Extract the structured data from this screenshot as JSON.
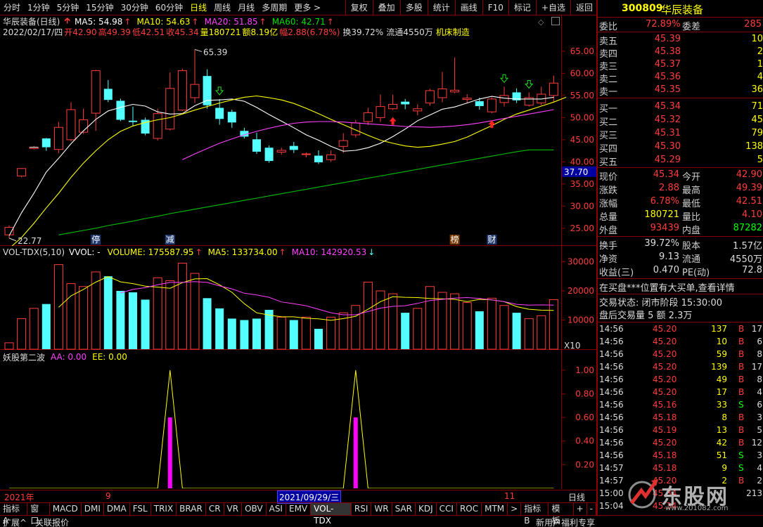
{
  "toolbar": {
    "periods": [
      "分时",
      "1分钟",
      "5分钟",
      "15分钟",
      "30分钟",
      "60分钟",
      "日线",
      "周线",
      "月线",
      "多周期",
      "更多 >"
    ],
    "active_period": "日线",
    "actions": [
      "复权",
      "叠加",
      "多股",
      "统计",
      "画线",
      "F10",
      "标记",
      "+自选",
      "返回"
    ]
  },
  "chart_header": {
    "name": "华辰装备(日线)",
    "ma5": "MA5: 54.98",
    "ma10": "MA10: 54.63",
    "ma20": "MA20: 51.85",
    "ma60": "MA60: 42.71",
    "date": "2022/02/17/四",
    "open": "开42.90",
    "high": "高49.39",
    "low": "低42.51",
    "close": "收45.34",
    "volume": "量180721",
    "amount": "额8.19亿",
    "amplitude": "幅2.88(6.78%)",
    "turnover": "换39.72%",
    "float": "流通4550万",
    "industry": "机床制造"
  },
  "price_axis": [
    "65.00",
    "60.00",
    "55.00",
    "50.00",
    "45.00",
    "40.00",
    "35.00",
    "30.00",
    "25.00"
  ],
  "price_marker": "37.70",
  "annotations": {
    "high_label": "65.39",
    "low_label": "22.77",
    "tags": [
      "停",
      "减",
      "榜",
      "财"
    ]
  },
  "volume_header": {
    "name": "VOL-TDX(5,10)",
    "vvol": "VVOL: -",
    "volume": "VOLUME: 175587.95",
    "ma5": "MA5: 133734.00",
    "ma10": "MA10: 142920.53"
  },
  "volume_axis": [
    "30000",
    "20000",
    "10000"
  ],
  "volume_unit": "X10",
  "indicator_header": {
    "name": "妖股第二波",
    "aa": "AA: 0.00",
    "ee": "EE: 0.00"
  },
  "indicator_axis": [
    "1.00",
    "0.80",
    "0.60",
    "0.40",
    "0.20"
  ],
  "time_axis": {
    "left": "2021年",
    "mark1": "9",
    "highlight": "2021/09/29/三",
    "mark2": "11",
    "right": "日线"
  },
  "bottom_tabs": [
    "指标A",
    "窗口",
    "MACD",
    "DMI",
    "DMA",
    "FSL",
    "TRIX",
    "BRAR",
    "CR",
    "VR",
    "OBV",
    "ASI",
    "EMV",
    "VOL-TDX",
    "RSI",
    "WR",
    "SAR",
    "KDJ",
    "CCI",
    "ROC",
    "MTM",
    ">",
    "指标B",
    "模 板",
    "+",
    "-"
  ],
  "active_tab": "VOL-TDX",
  "status_bar": {
    "left1": "扩展^",
    "left2": "关联报价",
    "right1": "新用户福利专享",
    "watermark": "东股网",
    "watermark_url": "www.201082.com"
  },
  "quote": {
    "code": "300809",
    "name": "华辰装备",
    "weibi_label": "委比",
    "weibi": "72.89%",
    "weicha_label": "委差",
    "weicha": "285",
    "sells": [
      {
        "label": "卖五",
        "price": "45.39",
        "qty": "10"
      },
      {
        "label": "卖四",
        "price": "45.38",
        "qty": "2"
      },
      {
        "label": "卖三",
        "price": "45.37",
        "qty": "1"
      },
      {
        "label": "卖二",
        "price": "45.36",
        "qty": "4"
      },
      {
        "label": "卖一",
        "price": "45.35",
        "qty": "36"
      }
    ],
    "buys": [
      {
        "label": "买一",
        "price": "45.34",
        "qty": "71"
      },
      {
        "label": "买二",
        "price": "45.32",
        "qty": "45"
      },
      {
        "label": "买三",
        "price": "45.31",
        "qty": "79"
      },
      {
        "label": "买四",
        "price": "45.30",
        "qty": "138"
      },
      {
        "label": "买五",
        "price": "45.29",
        "qty": "5"
      }
    ],
    "stats": [
      {
        "l1": "现价",
        "v1": "45.34",
        "l2": "今开",
        "v2": "42.90",
        "c1": "#ff3c3c",
        "c2": "#ff3c3c"
      },
      {
        "l1": "涨跌",
        "v1": "2.88",
        "l2": "最高",
        "v2": "49.39",
        "c1": "#ff3c3c",
        "c2": "#ff3c3c"
      },
      {
        "l1": "涨幅",
        "v1": "6.78%",
        "l2": "最低",
        "v2": "42.51",
        "c1": "#ff3c3c",
        "c2": "#ff3c3c"
      },
      {
        "l1": "总量",
        "v1": "180721",
        "l2": "量比",
        "v2": "4.10",
        "c1": "#ffff00",
        "c2": "#ff3c3c"
      },
      {
        "l1": "外盘",
        "v1": "93439",
        "l2": "内盘",
        "v2": "87282",
        "c1": "#ff3c3c",
        "c2": "#00ff00"
      }
    ],
    "stats2": [
      {
        "l1": "换手",
        "v1": "39.72%",
        "l2": "股本",
        "v2": "1.57亿"
      },
      {
        "l1": "净资",
        "v1": "9.13",
        "l2": "流通",
        "v2": "4550万"
      },
      {
        "l1": "收益(三)",
        "v1": "0.470",
        "l2": "PE(动)",
        "v2": "72.8"
      }
    ],
    "notice": "在买盘***位置有大买单,查看详情",
    "trade_status": "交易状态: 闭市阶段 15:30:00",
    "after_hours": "盘后交易量 5 额 2.3万"
  },
  "trades": [
    {
      "t": "14:56",
      "p": "45.20",
      "v": "137",
      "s": "B",
      "n": "17"
    },
    {
      "t": "14:56",
      "p": "45.20",
      "v": "10",
      "s": "B",
      "n": "6"
    },
    {
      "t": "14:56",
      "p": "45.20",
      "v": "59",
      "s": "B",
      "n": "8"
    },
    {
      "t": "14:56",
      "p": "45.20",
      "v": "139",
      "s": "B",
      "n": "17"
    },
    {
      "t": "14:56",
      "p": "45.20",
      "v": "49",
      "s": "B",
      "n": "8"
    },
    {
      "t": "14:56",
      "p": "45.20",
      "v": "17",
      "s": "B",
      "n": "4"
    },
    {
      "t": "14:56",
      "p": "45.16",
      "v": "33",
      "s": "S",
      "n": "6"
    },
    {
      "t": "14:56",
      "p": "45.18",
      "v": "8",
      "s": "B",
      "n": "3"
    },
    {
      "t": "14:56",
      "p": "45.19",
      "v": "13",
      "s": "B",
      "n": "5"
    },
    {
      "t": "14:56",
      "p": "45.20",
      "v": "42",
      "s": "B",
      "n": "12"
    },
    {
      "t": "14:56",
      "p": "45.18",
      "v": "51",
      "s": "S",
      "n": "3"
    },
    {
      "t": "14:57",
      "p": "45.18",
      "v": "9",
      "s": "S",
      "n": "4"
    },
    {
      "t": "14:57",
      "p": "45.20",
      "v": "2",
      "s": "B",
      "n": "2"
    },
    {
      "t": "15:00",
      "p": "45.34",
      "v": "",
      "s": "",
      "n": "213"
    },
    {
      "t": "15:04",
      "p": "45.34",
      "v": "",
      "s": "",
      "n": ""
    }
  ],
  "colors": {
    "up": "#ff3c3c",
    "down": "#54ffff",
    "ma5": "#ffffff",
    "ma10": "#ffff00",
    "ma20": "#ff40ff",
    "ma60": "#00c000",
    "grid": "#8b0000",
    "bg": "#000000"
  },
  "chart_data": [
    {
      "type": "candlestick",
      "title": "华辰装备(日线)",
      "ylim": [
        21,
        68
      ],
      "candles": [
        {
          "o": 23.5,
          "c": 25.2,
          "h": 25.6,
          "l": 22.77
        },
        {
          "o": 36.8,
          "c": 38.5,
          "h": 38.6,
          "l": 36.5
        },
        {
          "o": 43.0,
          "c": 43.3,
          "h": 43.6,
          "l": 42.8
        },
        {
          "o": 45.3,
          "c": 43.3,
          "h": 45.4,
          "l": 42.5
        },
        {
          "o": 42.8,
          "c": 47.8,
          "h": 49.0,
          "l": 42.0
        },
        {
          "o": 45.0,
          "c": 51.8,
          "h": 53.5,
          "l": 44.6
        },
        {
          "o": 46.7,
          "c": 49.5,
          "h": 52.0,
          "l": 46.3
        },
        {
          "o": 51.0,
          "c": 60.6,
          "h": 60.8,
          "l": 47.0
        },
        {
          "o": 56.5,
          "c": 54.0,
          "h": 58.5,
          "l": 53.5
        },
        {
          "o": 53.8,
          "c": 49.5,
          "h": 54.3,
          "l": 49.2
        },
        {
          "o": 49.3,
          "c": 49.0,
          "h": 52.5,
          "l": 48.0
        },
        {
          "o": 49.5,
          "c": 46.4,
          "h": 50.0,
          "l": 46.0
        },
        {
          "o": 45.3,
          "c": 50.9,
          "h": 52.0,
          "l": 44.8
        },
        {
          "o": 47.4,
          "c": 56.6,
          "h": 60.2,
          "l": 47.1
        },
        {
          "o": 51.7,
          "c": 60.6,
          "h": 61.0,
          "l": 51.5
        },
        {
          "o": 54.5,
          "c": 57.5,
          "h": 65.39,
          "l": 53.3
        },
        {
          "o": 59.4,
          "c": 52.8,
          "h": 60.9,
          "l": 52.0
        },
        {
          "o": 52.2,
          "c": 49.7,
          "h": 54.2,
          "l": 48.4
        },
        {
          "o": 51.3,
          "c": 48.9,
          "h": 51.8,
          "l": 47.7
        },
        {
          "o": 47.0,
          "c": 45.7,
          "h": 47.7,
          "l": 45.3
        },
        {
          "o": 45.1,
          "c": 42.3,
          "h": 46.6,
          "l": 41.8
        },
        {
          "o": 43.2,
          "c": 40.2,
          "h": 43.7,
          "l": 39.8
        },
        {
          "o": 42.2,
          "c": 42.6,
          "h": 43.2,
          "l": 41.6
        },
        {
          "o": 43.6,
          "c": 42.7,
          "h": 44.5,
          "l": 42.0
        },
        {
          "o": 41.8,
          "c": 41.8,
          "h": 42.1,
          "l": 41.0
        },
        {
          "o": 41.4,
          "c": 39.9,
          "h": 42.6,
          "l": 39.5
        },
        {
          "o": 40.5,
          "c": 41.6,
          "h": 42.6,
          "l": 40.0
        },
        {
          "o": 43.5,
          "c": 44.8,
          "h": 46.5,
          "l": 42.0
        },
        {
          "o": 46.1,
          "c": 48.8,
          "h": 49.5,
          "l": 45.5
        },
        {
          "o": 49.1,
          "c": 51.1,
          "h": 52.2,
          "l": 48.3
        },
        {
          "o": 50.0,
          "c": 52.5,
          "h": 55.2,
          "l": 49.0
        },
        {
          "o": 52.0,
          "c": 53.0,
          "h": 55.2,
          "l": 51.7
        },
        {
          "o": 53.6,
          "c": 53.0,
          "h": 54.2,
          "l": 51.9
        },
        {
          "o": 51.5,
          "c": 52.0,
          "h": 53.0,
          "l": 50.5
        },
        {
          "o": 53.3,
          "c": 56.1,
          "h": 56.5,
          "l": 52.7
        },
        {
          "o": 54.5,
          "c": 56.5,
          "h": 60.3,
          "l": 53.5
        },
        {
          "o": 55.8,
          "c": 56.2,
          "h": 63.6,
          "l": 55.5
        },
        {
          "o": 54.1,
          "c": 54.4,
          "h": 55.3,
          "l": 53.2
        },
        {
          "o": 53.7,
          "c": 52.6,
          "h": 54.5,
          "l": 51.8
        },
        {
          "o": 51.3,
          "c": 54.2,
          "h": 54.6,
          "l": 51.0
        },
        {
          "o": 53.4,
          "c": 55.0,
          "h": 57.0,
          "l": 52.5
        },
        {
          "o": 55.7,
          "c": 53.9,
          "h": 56.6,
          "l": 53.3
        },
        {
          "o": 52.8,
          "c": 54.5,
          "h": 55.7,
          "l": 52.5
        },
        {
          "o": 53.3,
          "c": 55.3,
          "h": 57.0,
          "l": 52.8
        },
        {
          "o": 55.0,
          "c": 57.8,
          "h": 59.5,
          "l": 53.6
        }
      ],
      "ma": {
        "MA5": [
          23.3,
          28.5,
          32.9,
          37.7,
          40.8,
          44.1,
          47.0,
          49.6,
          51.5,
          52.3,
          53.0,
          52.6,
          51.3,
          50.8,
          50.9,
          52.7,
          53.9,
          54.0,
          54.2,
          53.7,
          52.3,
          50.7,
          49.2,
          47.7,
          46.1,
          44.9,
          43.5,
          42.4,
          42.6,
          43.2,
          44.2,
          45.7,
          47.4,
          49.3,
          50.6,
          51.9,
          52.4,
          53.3,
          54.2,
          54.8,
          54.4,
          54.2,
          54.2,
          54.2,
          54.6
        ],
        "MA10": [
          20.4,
          22.9,
          26.1,
          29.6,
          32.9,
          36.5,
          39.7,
          42.5,
          45.0,
          46.9,
          48.1,
          48.9,
          49.5,
          50.0,
          50.8,
          51.7,
          52.5,
          53.3,
          54.0,
          54.6,
          54.9,
          54.5,
          54.0,
          53.2,
          52.1,
          50.9,
          49.6,
          48.4,
          47.2,
          46.0,
          44.9,
          44.2,
          43.6,
          43.3,
          43.5,
          44.0,
          44.6,
          45.6,
          46.9,
          48.2,
          49.6,
          50.8,
          51.7,
          52.6,
          53.5,
          54.6
        ],
        "MA20": [
          null,
          null,
          null,
          null,
          null,
          null,
          null,
          null,
          null,
          null,
          null,
          null,
          null,
          null,
          40.5,
          41.8,
          43.0,
          44.2,
          45.2,
          46.1,
          46.9,
          47.6,
          48.2,
          48.7,
          49.0,
          49.1,
          49.1,
          49.0,
          48.8,
          48.6,
          48.4,
          48.2,
          48.0,
          47.9,
          47.8,
          47.9,
          48.1,
          48.4,
          48.8,
          49.3,
          49.8,
          50.3,
          50.8,
          51.3,
          51.8
        ],
        "MA60": [
          null,
          null,
          null,
          null,
          23.5,
          24.0,
          24.5,
          25.0,
          25.6,
          26.1,
          26.6,
          27.2,
          27.7,
          28.3,
          28.8,
          29.3,
          29.8,
          30.3,
          30.8,
          31.3,
          31.8,
          32.3,
          32.8,
          33.3,
          33.8,
          34.3,
          34.8,
          35.3,
          35.8,
          36.3,
          36.8,
          37.3,
          37.8,
          38.3,
          38.8,
          39.3,
          39.8,
          40.3,
          40.8,
          41.3,
          41.8,
          42.3,
          42.7,
          42.7,
          42.7
        ]
      }
    },
    {
      "type": "bar",
      "title": "VOL-TDX(5,10)",
      "ylim": [
        0,
        33000
      ],
      "values": [
        2200,
        10500,
        14000,
        15500,
        29000,
        22500,
        21500,
        26500,
        25000,
        20000,
        19500,
        17000,
        24500,
        23500,
        29500,
        26000,
        17500,
        14000,
        10500,
        10000,
        10500,
        13500,
        11000,
        10000,
        11000,
        7000,
        11000,
        12500,
        15000,
        23000,
        20000,
        19000,
        12500,
        14000,
        21500,
        19500,
        19000,
        16000,
        13000,
        17500,
        15000,
        12500,
        10500,
        11500,
        17000
      ],
      "ma5": [
        null,
        null,
        null,
        null,
        14400,
        18300,
        20500,
        23000,
        24900,
        23100,
        22500,
        21600,
        21300,
        20900,
        22800,
        24100,
        24200,
        22100,
        19500,
        15600,
        12500,
        11700,
        11100,
        11100,
        10600,
        10400,
        9900,
        10500,
        11300,
        13700,
        16300,
        18000,
        17800,
        17700,
        17400,
        17300,
        17100,
        16300,
        17100,
        16900,
        16300,
        14600,
        13700,
        13400,
        13300
      ],
      "ma10": [
        null,
        null,
        null,
        null,
        null,
        null,
        null,
        null,
        null,
        19300,
        20500,
        21100,
        22100,
        22900,
        22900,
        23200,
        22900,
        21700,
        20700,
        19200,
        18600,
        17800,
        16200,
        15600,
        14900,
        13700,
        12500,
        11800,
        11800,
        12900,
        14100,
        14700,
        14900,
        15700,
        16700,
        17100,
        17500,
        17700,
        17400,
        16900,
        16300,
        15400,
        15100,
        15200,
        15100
      ]
    },
    {
      "type": "line",
      "title": "妖股第二波",
      "ylim": [
        0,
        1.1
      ],
      "values": [
        0,
        0,
        0,
        0,
        0,
        0,
        0,
        0,
        0,
        0,
        0,
        0,
        0,
        1,
        0,
        0,
        0,
        0,
        0,
        0,
        0,
        0,
        0,
        0,
        0,
        0,
        0,
        0,
        1,
        0,
        0,
        0,
        0,
        0,
        0,
        0,
        0,
        0,
        0,
        0,
        0,
        0,
        0,
        0,
        0
      ],
      "bars": [
        0,
        0,
        0,
        0,
        0,
        0,
        0,
        0,
        0,
        0,
        0,
        0,
        0,
        0.6,
        0,
        0,
        0,
        0,
        0,
        0,
        0,
        0,
        0,
        0,
        0,
        0,
        0,
        0,
        0.6,
        0,
        0,
        0,
        0,
        0,
        0,
        0,
        0,
        0,
        0,
        0,
        0,
        0,
        0,
        0,
        0
      ]
    }
  ]
}
